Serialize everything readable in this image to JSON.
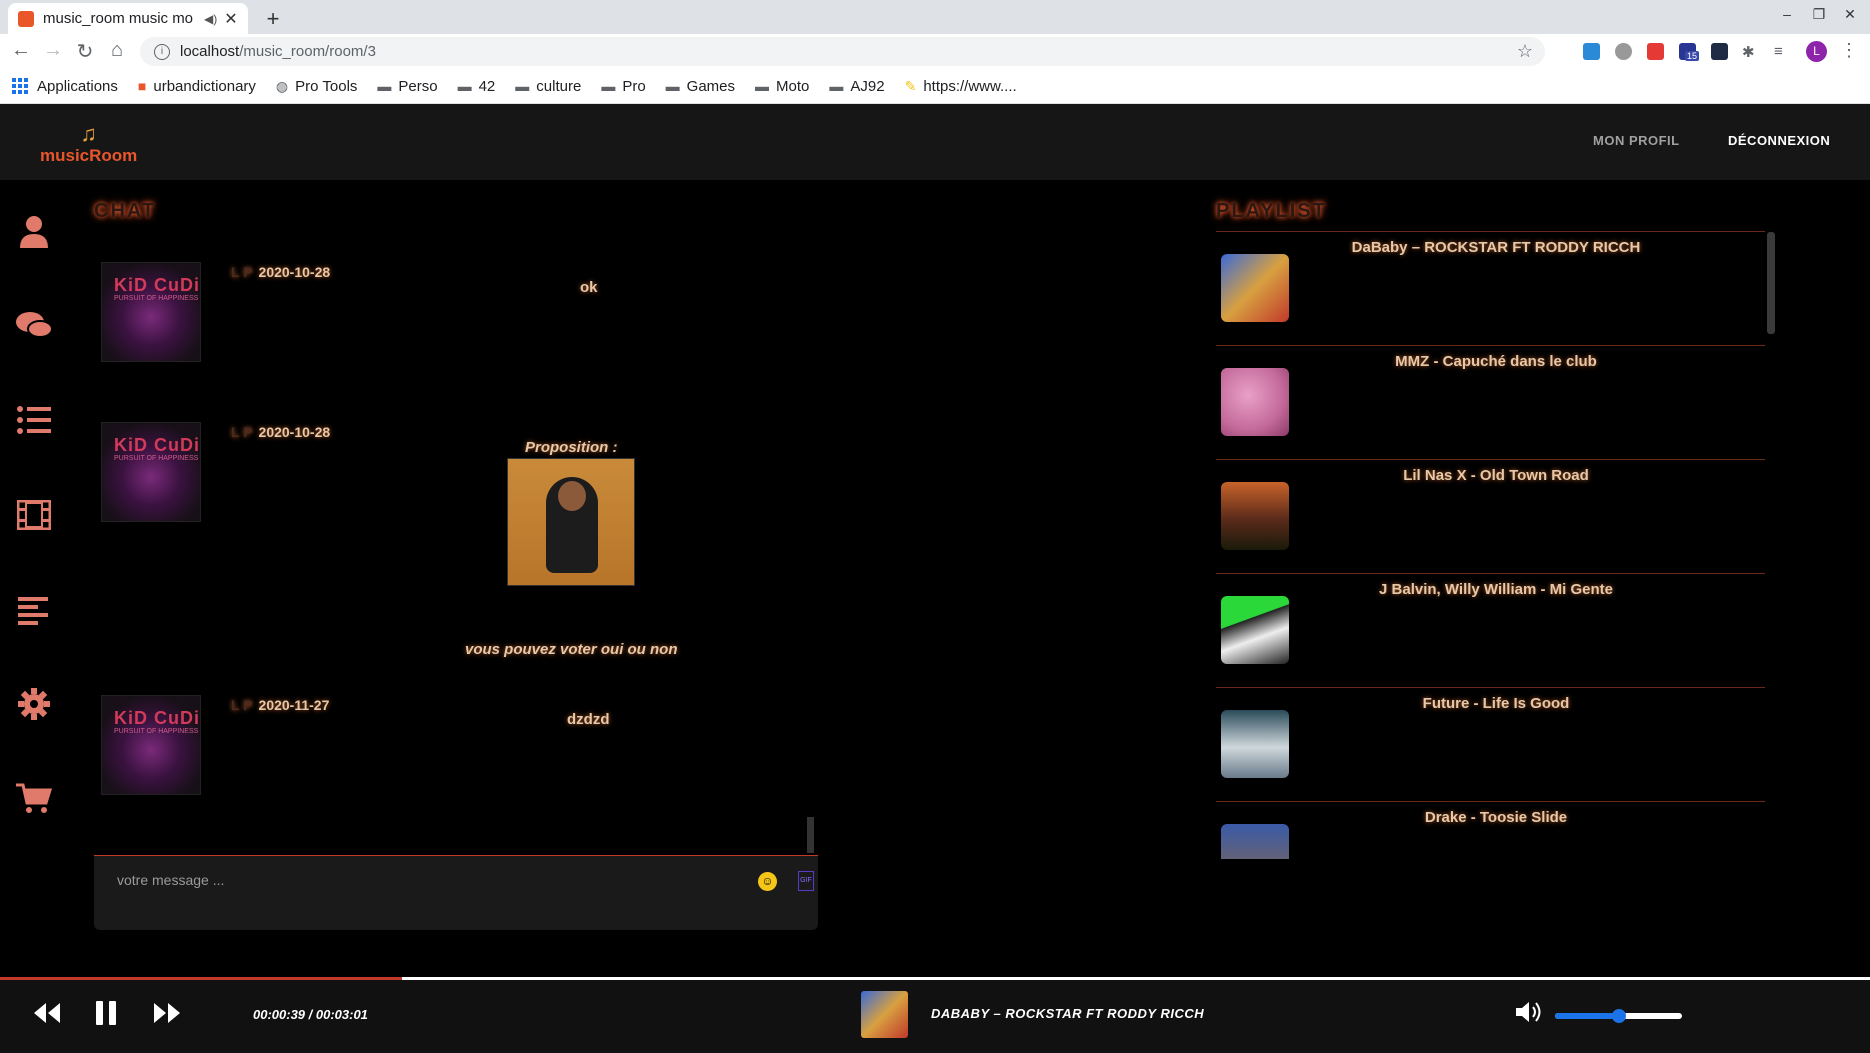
{
  "browser": {
    "tab_title": "music_room music mo",
    "tab_close": "✕",
    "new_tab": "+",
    "url_host": "localhost",
    "url_path": "/music_room/room/3",
    "bookmarks": [
      "Applications",
      "urbandictionary",
      "Pro Tools",
      "Perso",
      "42",
      "culture",
      "Pro",
      "Games",
      "Moto",
      "AJ92",
      "https://www...."
    ],
    "profile_initial": "L",
    "ext_badge": "15"
  },
  "header": {
    "logo": "musicRoom",
    "nav": [
      "MON PROFIL",
      "DÉCONNEXION"
    ]
  },
  "sidebar": [
    "user-icon",
    "chat-icon",
    "list-icon",
    "film-icon",
    "align-left-icon",
    "gear-icon",
    "cart-icon"
  ],
  "chat": {
    "title": "CHAT",
    "messages": [
      {
        "initials": "L P",
        "date": "2020-10-28",
        "text": "ok"
      },
      {
        "initials": "L P",
        "date": "2020-10-28",
        "proposal_label": "Proposition :",
        "vote_text": "vous pouvez voter oui ou non"
      },
      {
        "initials": "L P",
        "date": "2020-11-27",
        "text": "dzdzd"
      }
    ],
    "avatar_text": "KiD CuDi",
    "avatar_sub": "PURSUIT OF HAPPINESS",
    "input_placeholder": "votre message ...",
    "gif_label": "GIF"
  },
  "playlist": {
    "title": "PLAYLIST",
    "items": [
      {
        "title": "DaBaby – ROCKSTAR FT RODDY RICCH"
      },
      {
        "title": "MMZ - Capuché dans le club"
      },
      {
        "title": "Lil Nas X - Old Town Road"
      },
      {
        "title": "J Balvin, Willy William - Mi Gente"
      },
      {
        "title": "Future - Life Is Good"
      },
      {
        "title": "Drake - Toosie Slide"
      }
    ]
  },
  "player": {
    "time": "00:00:39 / 00:03:01",
    "now_playing": "DABABY – ROCKSTAR FT RODDY RICCH",
    "progress": 0.215,
    "volume": 0.5
  },
  "colors": {
    "accent": "#e8562a",
    "text_glow": "#e6c9a8",
    "divider": "#6a2a1a"
  }
}
